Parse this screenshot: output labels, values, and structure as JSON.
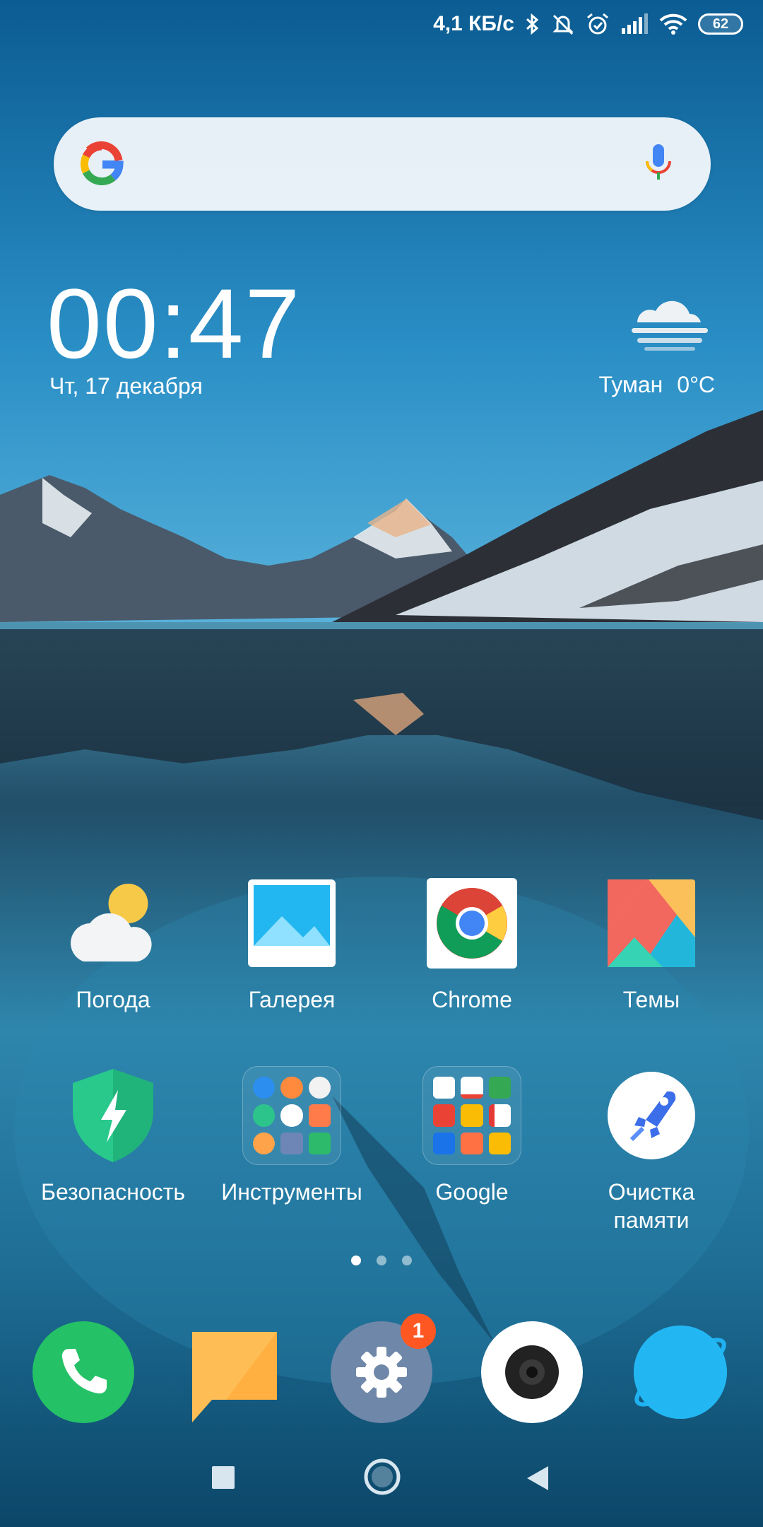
{
  "status_bar": {
    "speed": "4,1 КБ/с",
    "battery": "62"
  },
  "search": {},
  "clock": {
    "time": "00:47",
    "date": "Чт, 17 декабря"
  },
  "weather": {
    "condition": "Туман",
    "temperature": "0°C"
  },
  "apps_row1": [
    {
      "label": "Погода",
      "icon": "weather-app-icon"
    },
    {
      "label": "Галерея",
      "icon": "gallery-icon"
    },
    {
      "label": "Chrome",
      "icon": "chrome-icon"
    },
    {
      "label": "Темы",
      "icon": "themes-icon"
    }
  ],
  "apps_row2": [
    {
      "label": "Безопасность",
      "icon": "security-icon"
    },
    {
      "label": "Инструменты",
      "icon": "tools-folder-icon"
    },
    {
      "label": "Google",
      "icon": "google-folder-icon"
    },
    {
      "label": "Очистка памяти",
      "icon": "cleaner-icon"
    }
  ],
  "dock": {
    "settings_badge": "1"
  },
  "page_indicator": {
    "count": 3,
    "active": 1
  }
}
